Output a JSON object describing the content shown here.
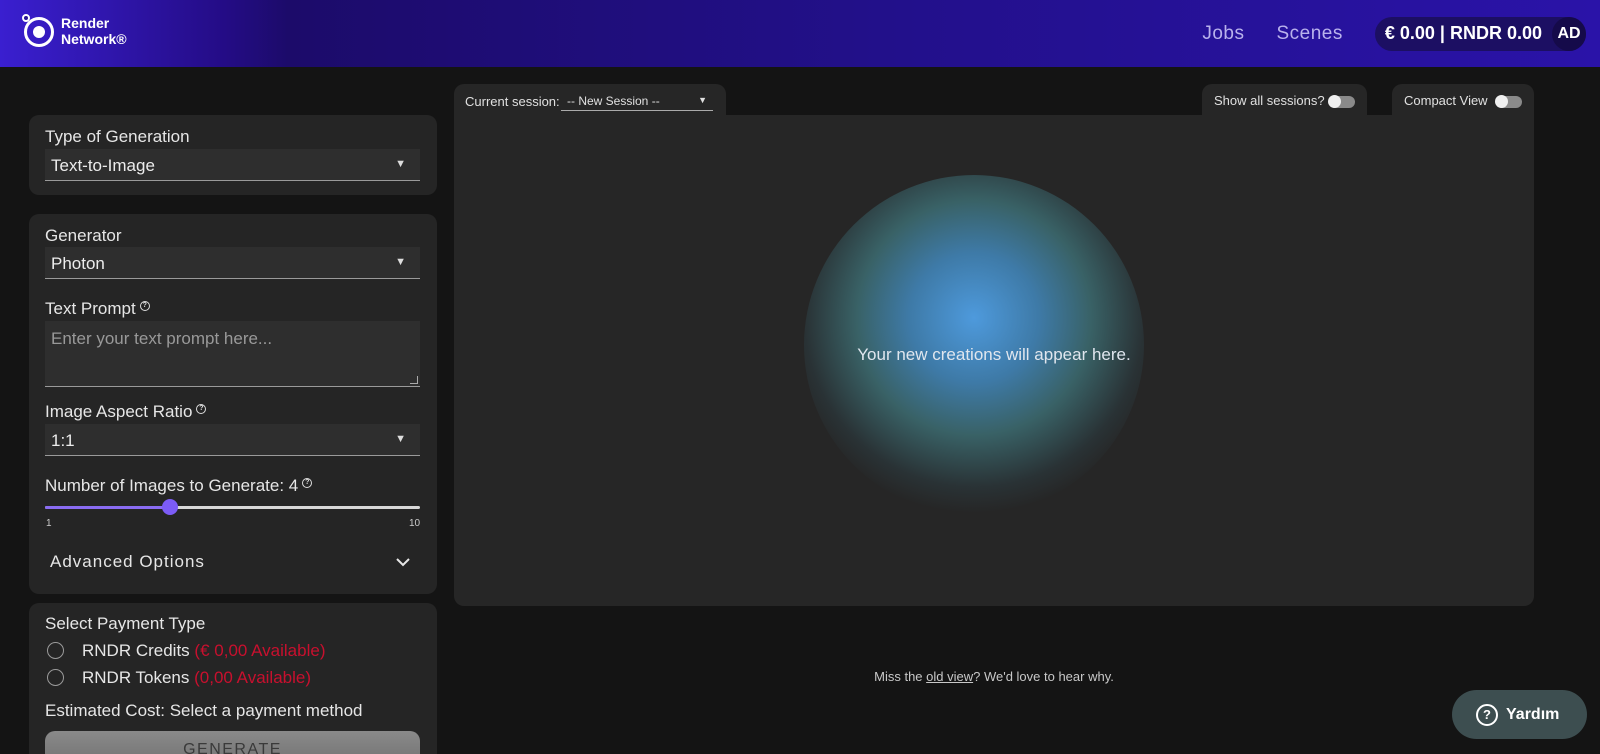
{
  "header": {
    "logo_line1": "Render",
    "logo_line2": "Network®",
    "nav": [
      "Jobs",
      "Scenes"
    ],
    "balance": "€ 0.00 | RNDR 0.00",
    "avatar_initials": "AD"
  },
  "generation_type": {
    "label": "Type of Generation",
    "value": "Text-to-Image"
  },
  "generator_panel": {
    "generator_label": "Generator",
    "generator_value": "Photon",
    "prompt_label": "Text Prompt",
    "prompt_placeholder": "Enter your text prompt here...",
    "aspect_label": "Image Aspect Ratio",
    "aspect_value": "1:1",
    "count_label": "Number of Images to Generate: 4",
    "count_value": 4,
    "count_min": "1",
    "count_max": "10",
    "advanced_label": "Advanced Options"
  },
  "payment": {
    "label": "Select Payment Type",
    "options": [
      {
        "name": "RNDR Credits",
        "available": "(€ 0,00 Available)"
      },
      {
        "name": "RNDR Tokens",
        "available": "(0,00 Available)"
      }
    ],
    "estimated_cost": "Estimated Cost: Select a payment method",
    "generate_label": "GENERATE"
  },
  "session_bar": {
    "current_label": "Current session:",
    "current_value": "-- New Session --",
    "show_all_label": "Show all sessions?",
    "compact_label": "Compact View"
  },
  "main": {
    "placeholder": "Your new creations will appear here."
  },
  "feedback": {
    "prefix": "Miss the ",
    "link": "old view",
    "suffix": "? We'd love to hear why."
  },
  "help_button": {
    "label": "Yardım"
  },
  "colors": {
    "accent": "#7c5cf6",
    "header": "#22108a",
    "warning": "#c8102e"
  }
}
